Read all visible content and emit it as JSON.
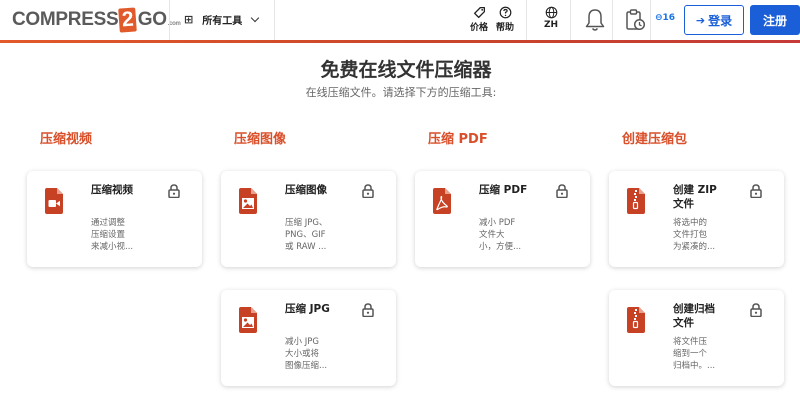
{
  "header": {
    "logo": {
      "left": "COMPRESS",
      "num": "2",
      "right": "GO",
      "suffix": ".com"
    },
    "all_tools": "所有工具",
    "pricing": "价格",
    "help": "帮助",
    "language": "ZH",
    "counter": "16",
    "login": "登录",
    "signup": "注册"
  },
  "page": {
    "title": "免费在线文件压缩器",
    "subtitle": "在线压缩文件。请选择下方的压缩工具:"
  },
  "categories": [
    {
      "heading": "压缩视频"
    },
    {
      "heading": "压缩图像"
    },
    {
      "heading": "压缩 PDF"
    },
    {
      "heading": "创建压缩包"
    }
  ],
  "cards": [
    {
      "title": "压缩视频",
      "desc": [
        "通过调整",
        "压缩设置",
        "来减小视..."
      ],
      "icon": "video-file-icon"
    },
    {
      "title": "压缩图像",
      "desc": [
        "压缩 JPG、",
        "PNG、GIF",
        "或 RAW ..."
      ],
      "icon": "image-file-icon"
    },
    {
      "title": "压缩 PDF",
      "desc": [
        "减小 PDF",
        "文件大",
        "小，方便..."
      ],
      "icon": "pdf-file-icon"
    },
    {
      "title_lines": [
        "创建 ZIP",
        "文件"
      ],
      "desc": [
        "将选中的",
        "文件打包",
        "为紧凑的..."
      ],
      "icon": "zip-file-icon"
    },
    {
      "title": "压缩 JPG",
      "desc": [
        "减小 JPG",
        "大小或将",
        "图像压缩..."
      ],
      "icon": "image-file-icon"
    },
    {
      "title_lines": [
        "创建归档",
        "文件"
      ],
      "desc": [
        "将文件压",
        "缩到一个",
        "归档中。..."
      ],
      "icon": "zip-file-icon"
    }
  ],
  "colors": {
    "accent": "#d94f2a",
    "primary": "#1a5fd8"
  }
}
